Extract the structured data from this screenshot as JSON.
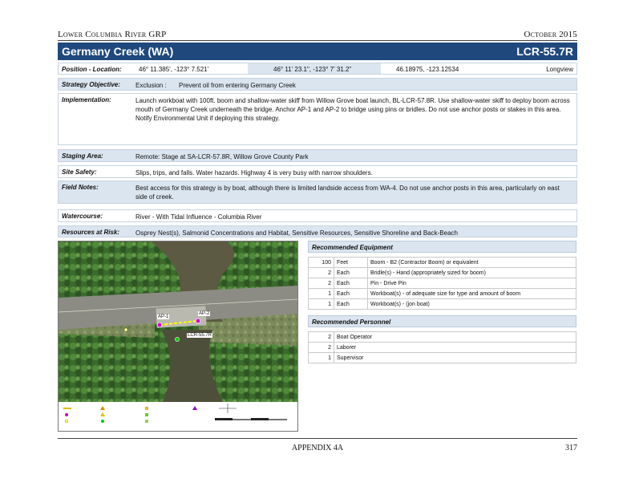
{
  "header": {
    "left": "Lower Columbia River GRP",
    "right": "October 2015"
  },
  "title": {
    "name": "Germany Creek (WA)",
    "code": "LCR-55.7R"
  },
  "position": {
    "label": "Position - Location:",
    "decimal_minutes": "46° 11.385', -123° 7.521'",
    "dms": "46° 11' 23.1\", -123° 7' 31.2\"",
    "decimal": "46.18975, -123.12534",
    "place": "Longview"
  },
  "strategy": {
    "label": "Strategy Objective:",
    "type": "Exclusion :",
    "text": "Prevent oil from entering Germany Creek"
  },
  "implementation": {
    "label": "Implementation:",
    "text": "Launch workboat with 100ft. boom and shallow-water skiff from Willow Grove boat launch, BL-LCR-57.8R. Use shallow-water skiff to deploy boom across mouth of Germany Creek underneath the bridge. Anchor AP-1 and AP-2 to bridge using pins or bridles. Do not use anchor posts or stakes in this area. Notify Environmental Unit if deploying this strategy."
  },
  "staging": {
    "label": "Staging Area:",
    "text": "Remote:  Stage at SA-LCR-57.8R, Willow Grove County Park"
  },
  "safety": {
    "label": "Site Safety:",
    "text": "Slips, trips, and falls. Water hazards. Highway 4 is very busy with narrow shoulders."
  },
  "field_notes": {
    "label": "Field Notes:",
    "text": "Best access for this strategy is by boat, although there is limited landside access from WA-4. Do not use anchor posts in this area, particularly on east side of creek."
  },
  "watercourse": {
    "label": "Watercourse:",
    "text": "River - With Tidal Influence  - Columbia River"
  },
  "resources": {
    "label": "Resources at Risk:",
    "text": "Osprey Nest(s), Salmonid Concentrations and Habitat, Sensitive Resources, Sensitive Shoreline and Back-Beach"
  },
  "map": {
    "labels": {
      "ap1": "AP-1",
      "ap2": "AP-2",
      "site": "LCR-55.7R"
    },
    "colors": {
      "boom": "#ffff00",
      "anchor": "#cc00cc",
      "site": "#00cc00"
    }
  },
  "equipment": {
    "title": "Recommended Equipment",
    "rows": [
      {
        "qty": "100",
        "unit": "Feet",
        "desc": "Boom - B2 (Contractor Boom) or equivalent"
      },
      {
        "qty": "2",
        "unit": "Each",
        "desc": "Bridle(s) - Hand (appropriately sized for boom)"
      },
      {
        "qty": "2",
        "unit": "Each",
        "desc": "Pin - Drive Pin"
      },
      {
        "qty": "1",
        "unit": "Each",
        "desc": "Workboat(s) - of adequate size for type and amount of boom"
      },
      {
        "qty": "1",
        "unit": "Each",
        "desc": "Workboat(s) - (jon boat)"
      }
    ]
  },
  "personnel": {
    "title": "Recommended Personnel",
    "rows": [
      {
        "qty": "2",
        "desc": "Boat Operator"
      },
      {
        "qty": "2",
        "desc": "Laborer"
      },
      {
        "qty": "1",
        "desc": "Supervisor"
      }
    ]
  },
  "footer": {
    "center": "APPENDIX 4A",
    "page": "317"
  }
}
